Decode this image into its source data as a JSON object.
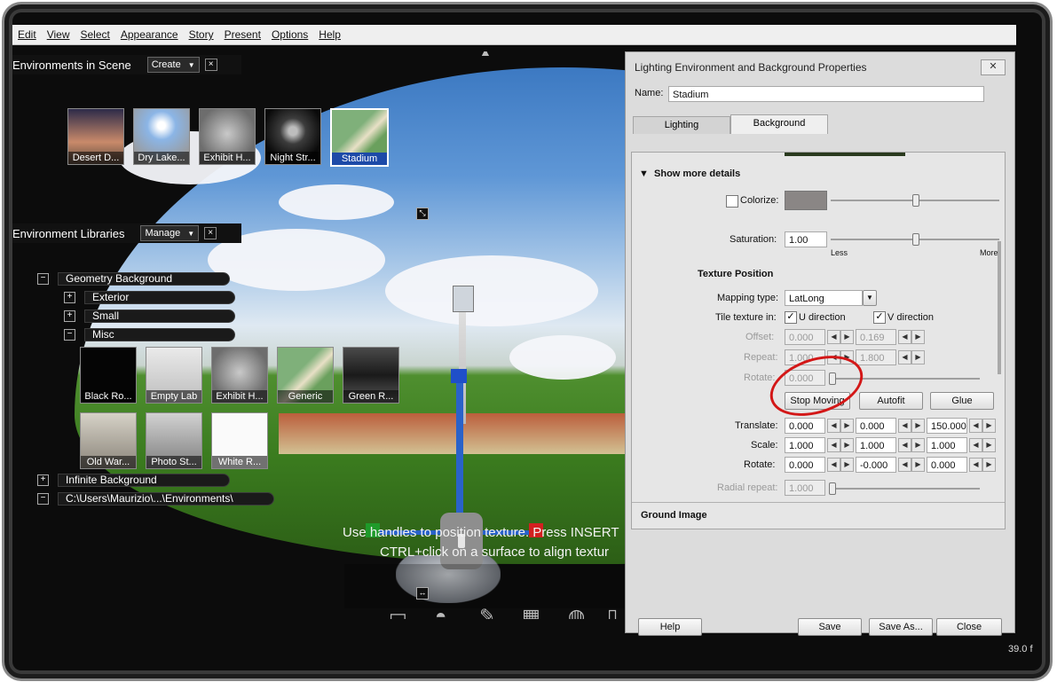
{
  "menu": [
    "Edit",
    "View",
    "Select",
    "Appearance",
    "Story",
    "Present",
    "Options",
    "Help"
  ],
  "environments_panel": {
    "title": "Environments in Scene",
    "create_label": "Create",
    "close": "×",
    "thumbs": [
      "Desert D...",
      "Dry Lake...",
      "Exhibit H...",
      "Night Str...",
      "Stadium"
    ]
  },
  "libraries_panel": {
    "title": "Environment Libraries",
    "manage_label": "Manage",
    "close": "×",
    "tree": {
      "geometry_background": "Geometry Background",
      "exterior": "Exterior",
      "small": "Small",
      "misc": "Misc",
      "infinite_background": "Infinite Background",
      "path": "C:\\Users\\Maurizio\\...\\Environments\\"
    },
    "misc_row1": [
      "Black Ro...",
      "Empty Lab",
      "Exhibit H...",
      "Generic",
      "Green R..."
    ],
    "misc_row2": [
      "Old War...",
      "Photo St...",
      "White R..."
    ]
  },
  "viewport": {
    "hint_line1": "Use handles to position texture. Press INSERT",
    "hint_line2": "CTRL+click on a surface to align textur",
    "fps": "39.0 f"
  },
  "dialog": {
    "title": "Lighting Environment and Background Properties",
    "close": "✕",
    "name_label": "Name:",
    "name_value": "Stadium",
    "tabs": [
      "Lighting",
      "Background"
    ],
    "active_tab": "Background",
    "show_more": "Show more details",
    "colorize_label": "Colorize:",
    "saturation_label": "Saturation:",
    "saturation_value": "1.00",
    "less": "Less",
    "more": "More",
    "texture_position": "Texture Position",
    "mapping_label": "Mapping type:",
    "mapping_value": "LatLong",
    "tile_label": "Tile texture in:",
    "u_dir": "U direction",
    "v_dir": "V direction",
    "offset_label": "Offset:",
    "offset_u": "0.000",
    "offset_v": "0.169",
    "repeat_label": "Repeat:",
    "repeat_u": "1.000",
    "repeat_v": "1.800",
    "rotate_label": "Rotate:",
    "rotate_value": "0.000",
    "stop_moving": "Stop Moving",
    "autofit": "Autofit",
    "glue": "Glue",
    "translate_label": "Translate:",
    "translate": [
      "0.000",
      "0.000",
      "150.000"
    ],
    "scale_label": "Scale:",
    "scale": [
      "1.000",
      "1.000",
      "1.000"
    ],
    "rotate3_label": "Rotate:",
    "rotate3": [
      "0.000",
      "-0.000",
      "0.000"
    ],
    "radial_label": "Radial repeat:",
    "radial_value": "1.000",
    "ground_image": "Ground Image",
    "help": "Help",
    "save": "Save",
    "save_as": "Save As...",
    "close_btn": "Close"
  },
  "colors": {
    "accent": "#1d4aa8",
    "annotation": "#d31717",
    "swatch": "#8a8685"
  },
  "icons": [
    "folder-icon",
    "dome-icon",
    "light-icon",
    "cube-sphere-icon",
    "globe-icon",
    "page-icon",
    "arrow-up-icon",
    "expand-icon",
    "move-icon"
  ]
}
